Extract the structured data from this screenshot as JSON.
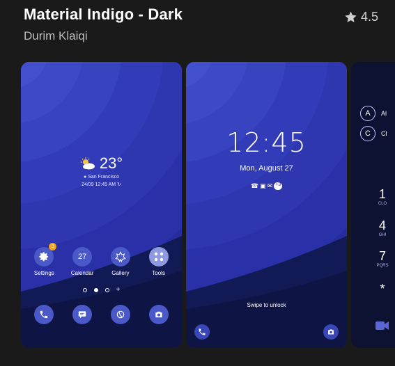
{
  "app": {
    "title": "Material Indigo - Dark",
    "developer": "Durim Klaiqi",
    "rating": "4.5",
    "rating_icon": "star-icon"
  },
  "colors": {
    "background": "#1a1a1a",
    "wallpaper_blue": "#2a2fa6",
    "wallpaper_dark": "#0d1233",
    "icon_circle": "#4a58c8",
    "badge": "#f2a21e"
  },
  "screen1": {
    "weather": {
      "temp": "23°",
      "location": "San Francisco",
      "datetime": "24/09 12:45 AM"
    },
    "apps": [
      {
        "label": "Settings",
        "icon": "gear-icon",
        "badge": "3"
      },
      {
        "label": "Calendar",
        "icon": "calendar-icon",
        "text": "27"
      },
      {
        "label": "Gallery",
        "icon": "gallery-icon"
      },
      {
        "label": "Tools",
        "icon": "tools-icon"
      }
    ],
    "dock": [
      "phone-icon",
      "messages-icon",
      "browser-icon",
      "camera-icon"
    ]
  },
  "screen2": {
    "time": "12:45",
    "date": "Mon, August 27",
    "notification_count": "+3",
    "hint": "Swipe to unlock"
  },
  "screen3": {
    "contacts": [
      {
        "initial": "A",
        "name": "Al"
      },
      {
        "initial": "C",
        "name": "Cl"
      }
    ],
    "keys": [
      {
        "num": "1",
        "sub": "CLO"
      },
      {
        "num": "4",
        "sub": "GHI"
      },
      {
        "num": "7",
        "sub": "PQRS"
      },
      {
        "num": "*",
        "sub": ""
      }
    ]
  }
}
